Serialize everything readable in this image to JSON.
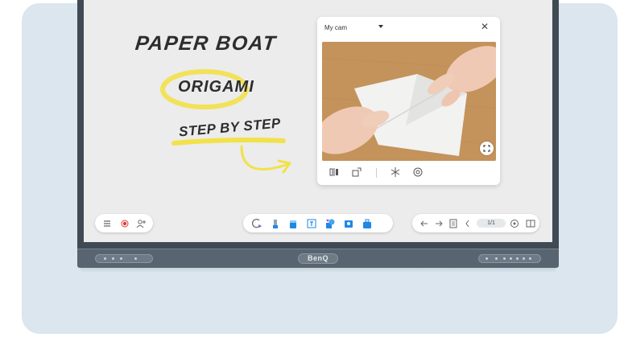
{
  "whiteboard": {
    "title": "PAPER BOAT",
    "subtitle": "ORIGAMI",
    "caption": "STEP BY STEP"
  },
  "camera": {
    "source_label": "My cam",
    "close_glyph": "✕"
  },
  "toolbar": {
    "page_indicator": "1/1"
  },
  "device": {
    "brand": "BenQ"
  },
  "colors": {
    "highlight": "#f2e14a",
    "pen": "#2d2d2d",
    "accent_blue": "#1e88e5",
    "record_red": "#e53935"
  }
}
